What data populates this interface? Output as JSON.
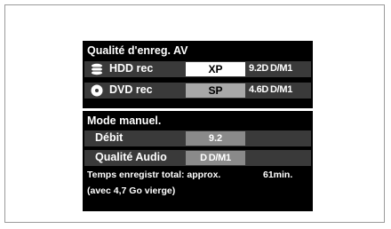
{
  "rec_quality": {
    "title": "Qualité d'enreg. AV",
    "hdd": {
      "label": "HDD rec",
      "mode": "XP",
      "rate": "9.2D D/M1",
      "icon": "hdd-disc-icon"
    },
    "dvd": {
      "label": "DVD rec",
      "mode": "SP",
      "rate": "4.6D D/M1",
      "icon": "dvd-disc-icon"
    }
  },
  "manual_mode": {
    "title": "Mode manuel.",
    "bitrate": {
      "label": "Débit",
      "value": "9.2"
    },
    "audio": {
      "label": "Qualité Audio",
      "value": "D D/M1"
    }
  },
  "footer": {
    "total_label": "Temps enregistr total: approx.",
    "total_value": "61min.",
    "note": "(avec 4,7 Go vierge)"
  },
  "colors": {
    "panel": "#000000",
    "row": "#3a3a3a",
    "selected_box": "#ffffff",
    "dim_box": "#a8a8a8"
  }
}
